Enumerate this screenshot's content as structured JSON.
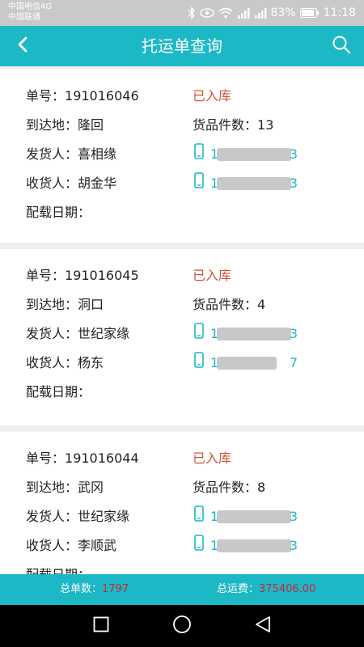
{
  "statusbar": {
    "carrier_line1": "中国电信4G",
    "carrier_line2": "中国联通",
    "battery": "83%",
    "time": "11:18"
  },
  "header": {
    "title": "托运单查询"
  },
  "labels": {
    "order_no": "单号：",
    "destination": "到达地：",
    "goods_count": "货品件数：",
    "sender": "发货人：",
    "receiver": "收货人：",
    "load_date": "配载日期："
  },
  "orders": [
    {
      "order_no": "191016046",
      "status": "已入库",
      "destination": "隆回",
      "goods_count": "13",
      "sender": "喜相缘",
      "sender_phone_first": "1",
      "sender_phone_last": "3",
      "receiver": "胡金华",
      "receiver_phone_first": "1",
      "receiver_phone_last": "3",
      "load_date": ""
    },
    {
      "order_no": "191016045",
      "status": "已入库",
      "destination": "洞口",
      "goods_count": "4",
      "sender": "世纪家缘",
      "sender_phone_first": "1",
      "sender_phone_last": "3",
      "receiver": "杨东",
      "receiver_phone_first": "1",
      "receiver_phone_last": "7",
      "load_date": ""
    },
    {
      "order_no": "191016044",
      "status": "已入库",
      "destination": "武冈",
      "goods_count": "8",
      "sender": "世纪家缘",
      "sender_phone_first": "1",
      "sender_phone_last": "3",
      "receiver": "李顺武",
      "receiver_phone_first": "1",
      "receiver_phone_last": "3",
      "load_date": ""
    }
  ],
  "summary": {
    "total_orders_label": "总单数：",
    "total_orders": "1797",
    "total_freight_label": "总运费：",
    "total_freight": "375406.00"
  },
  "colors": {
    "accent": "#1cb8c5",
    "status": "#d0533b",
    "summary_value": "#c8283a"
  }
}
